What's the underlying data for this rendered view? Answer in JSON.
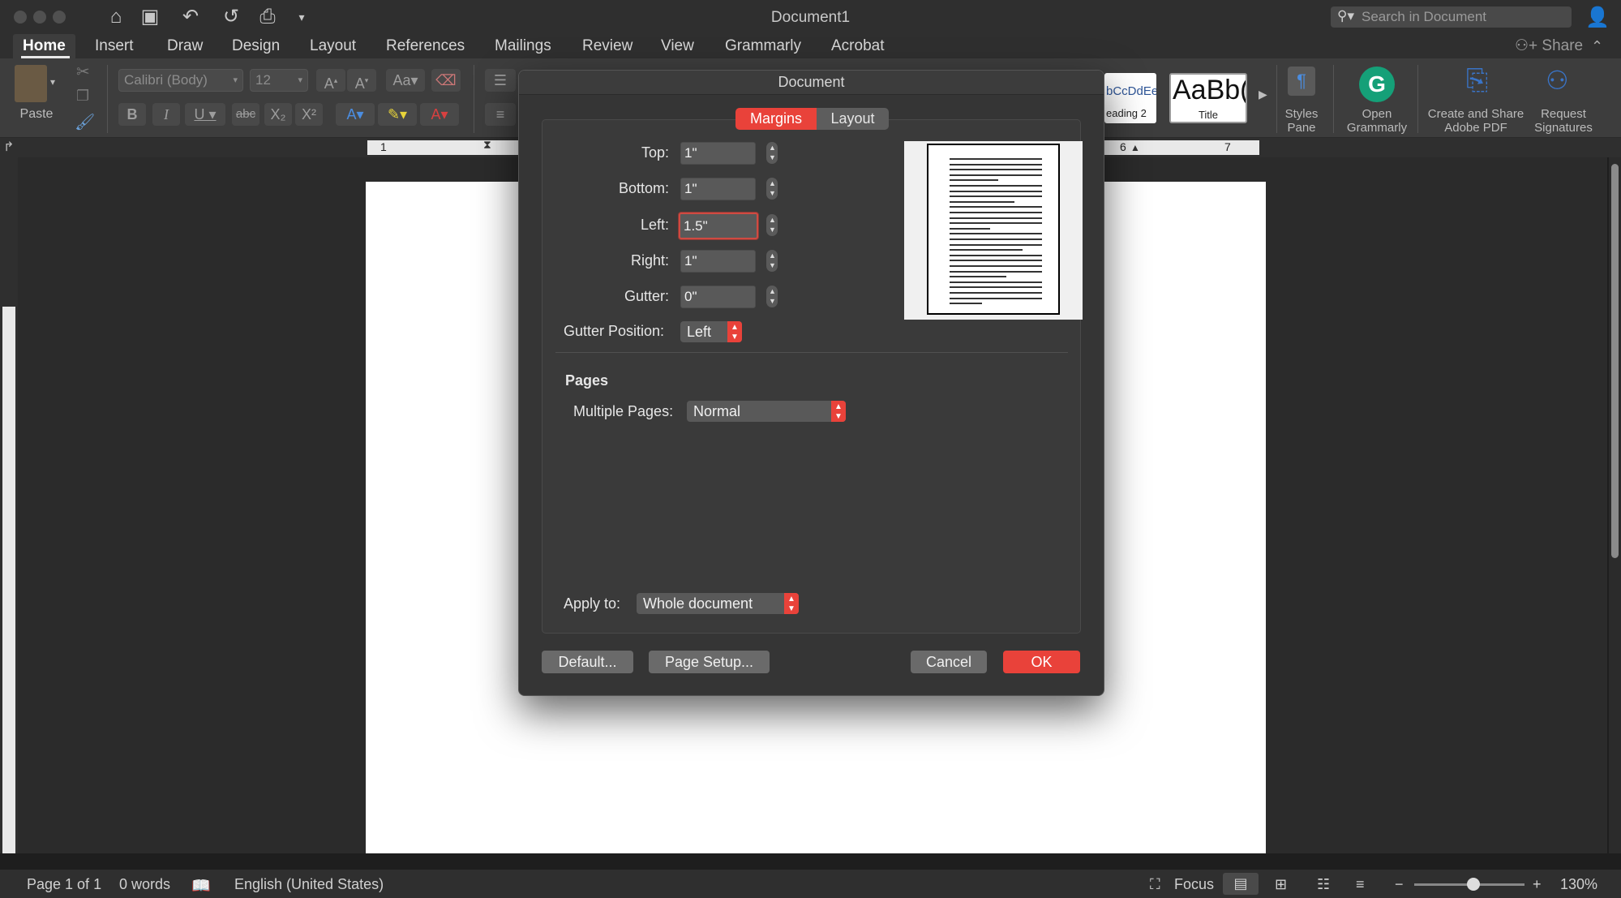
{
  "window": {
    "title": "Document1"
  },
  "quick_access": {
    "icons": [
      "home-icon",
      "save-icon",
      "undo-icon",
      "redo-icon",
      "print-icon",
      "customize-icon"
    ]
  },
  "search": {
    "placeholder": "Search in Document"
  },
  "tabs": [
    "Home",
    "Insert",
    "Draw",
    "Design",
    "Layout",
    "References",
    "Mailings",
    "Review",
    "View",
    "Grammarly",
    "Acrobat"
  ],
  "share_label": "Share",
  "ribbon": {
    "paste_label": "Paste",
    "font_name": "Calibri (Body)",
    "font_size": "12",
    "style_heading2_sample": "bCcDdEe",
    "style_heading2_label": "eading 2",
    "style_title_sample": "AaBb(",
    "style_title_label": "Title",
    "styles_pane_label_1": "Styles",
    "styles_pane_label_2": "Pane",
    "grammarly_label_1": "Open",
    "grammarly_label_2": "Grammarly",
    "acrobat_pdf_label_1": "Create and Share",
    "acrobat_pdf_label_2": "Adobe PDF",
    "signatures_label_1": "Request",
    "signatures_label_2": "Signatures"
  },
  "ruler": {
    "numbers": [
      "1",
      "6",
      "7"
    ]
  },
  "dialog": {
    "title": "Document",
    "tab_margins": "Margins",
    "tab_layout": "Layout",
    "fields": {
      "top_label": "Top:",
      "top_value": "1\"",
      "bottom_label": "Bottom:",
      "bottom_value": "1\"",
      "left_label": "Left:",
      "left_value": "1.5\"",
      "right_label": "Right:",
      "right_value": "1\"",
      "gutter_label": "Gutter:",
      "gutter_value": "0\""
    },
    "gutter_position_label": "Gutter Position:",
    "gutter_position_value": "Left",
    "pages_title": "Pages",
    "multiple_pages_label": "Multiple Pages:",
    "multiple_pages_value": "Normal",
    "apply_to_label": "Apply to:",
    "apply_to_value": "Whole document",
    "default_button": "Default...",
    "page_setup_button": "Page Setup...",
    "cancel_button": "Cancel",
    "ok_button": "OK"
  },
  "status": {
    "page": "Page 1 of 1",
    "words": "0 words",
    "language": "English (United States)",
    "focus": "Focus",
    "zoom": "130%"
  },
  "colors": {
    "accent": "#e9423a",
    "dialog_bg": "#353535",
    "ribbon_bg": "#3d3d3d"
  }
}
